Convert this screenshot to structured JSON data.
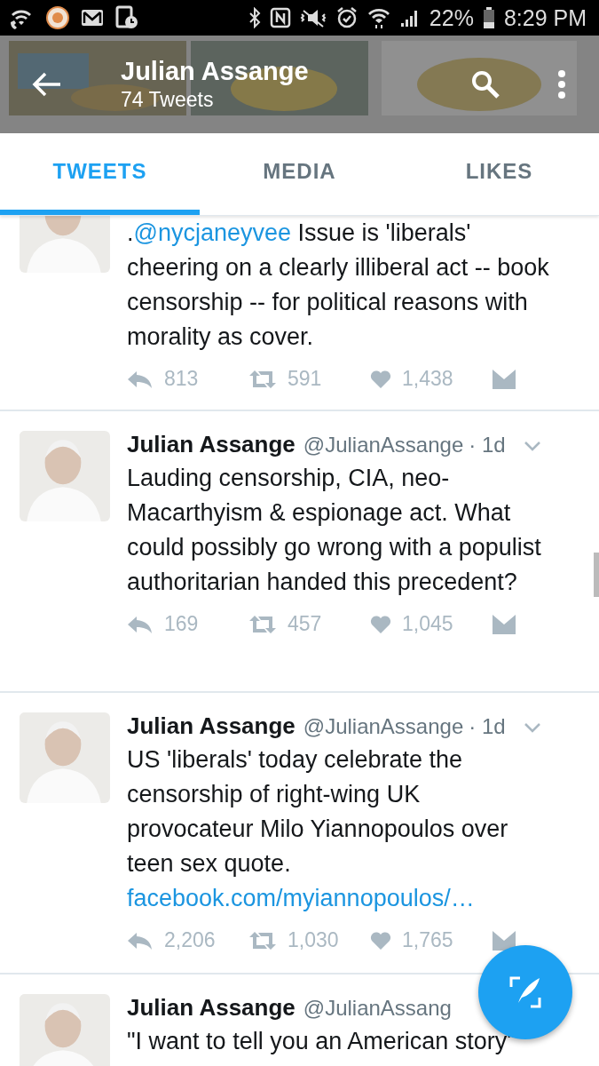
{
  "status_bar": {
    "battery": "22%",
    "time": "8:29 PM"
  },
  "header": {
    "name": "Julian Assange",
    "count": "74 Tweets"
  },
  "tabs": [
    {
      "label": "TWEETS",
      "selected": true
    },
    {
      "label": "MEDIA",
      "selected": false
    },
    {
      "label": "LIKES",
      "selected": false
    }
  ],
  "tweets": [
    {
      "body": [
        {
          "kind": "text",
          "text": "."
        },
        {
          "kind": "link",
          "text": "@nycjaneyvee"
        },
        {
          "kind": "text",
          "text": " Issue is 'liberals' cheering on a clearly illiberal act -- book censorship -- for political reasons with morality as cover."
        }
      ],
      "replies": "813",
      "retweets": "591",
      "likes": "1,438"
    },
    {
      "name": "Julian Assange",
      "handle": "@JulianAssange",
      "time": "· 1d",
      "body": [
        {
          "kind": "text",
          "text": "Lauding censorship, CIA, neo-Macarthyism & espionage act. What could possibly go wrong with a populist authoritarian handed this precedent?"
        }
      ],
      "replies": "169",
      "retweets": "457",
      "likes": "1,045"
    },
    {
      "name": "Julian Assange",
      "handle": "@JulianAssange",
      "time": "· 1d",
      "body": [
        {
          "kind": "text",
          "text": "US 'liberals' today celebrate the censorship of right-wing UK provocateur Milo Yiannopoulos over teen sex quote. "
        },
        {
          "kind": "link",
          "text": "facebook.com/myiannopoulos/…"
        }
      ],
      "replies": "2,206",
      "retweets": "1,030",
      "likes": "1,765"
    },
    {
      "name": "Julian Assange",
      "handle": "@JulianAssang",
      "body": [
        {
          "kind": "text",
          "text": "\"I want to tell you an American story\""
        }
      ]
    }
  ]
}
